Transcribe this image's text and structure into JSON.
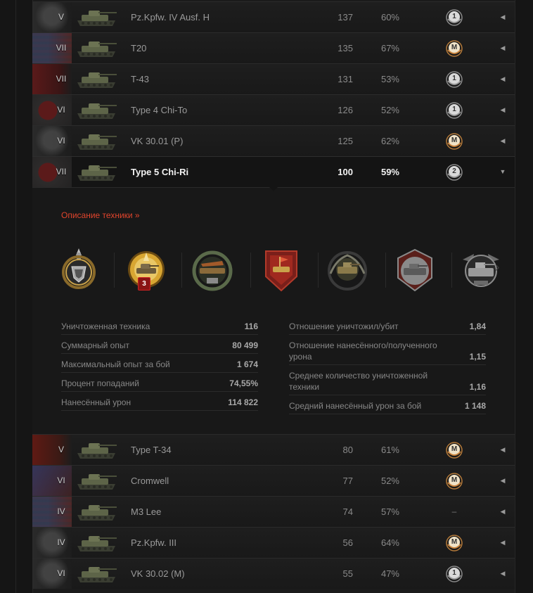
{
  "rows_top": [
    {
      "nation": "germany",
      "tier": "V",
      "name": "Pz.Kpfw. IV Ausf. H",
      "battles": "137",
      "wins": "60%",
      "mastery": "1",
      "mastery_icon": "class-1-badge-icon"
    },
    {
      "nation": "usa",
      "tier": "VII",
      "name": "T20",
      "battles": "135",
      "wins": "67%",
      "mastery": "M",
      "mastery_icon": "ace-tanker-badge-icon"
    },
    {
      "nation": "ussr",
      "tier": "VII",
      "name": "T-43",
      "battles": "131",
      "wins": "53%",
      "mastery": "1",
      "mastery_icon": "class-1-badge-icon"
    },
    {
      "nation": "japan",
      "tier": "VI",
      "name": "Type 4 Chi-To",
      "battles": "126",
      "wins": "52%",
      "mastery": "1",
      "mastery_icon": "class-1-badge-icon"
    },
    {
      "nation": "germany",
      "tier": "VI",
      "name": "VK 30.01 (P)",
      "battles": "125",
      "wins": "62%",
      "mastery": "M",
      "mastery_icon": "ace-tanker-badge-icon"
    },
    {
      "nation": "japan",
      "tier": "VII",
      "name": "Type 5 Chi-Ri",
      "battles": "100",
      "wins": "59%",
      "mastery": "2",
      "mastery_icon": "class-2-badge-icon"
    }
  ],
  "details": {
    "description_link": "Описание техники »",
    "medal_count": "3",
    "stats_left": [
      {
        "label": "Уничтоженная техника",
        "value": "116"
      },
      {
        "label": "Суммарный опыт",
        "value": "80 499"
      },
      {
        "label": "Максимальный опыт за бой",
        "value": "1 674"
      },
      {
        "label": "Процент попаданий",
        "value": "74,55%"
      },
      {
        "label": "Нанесённый урон",
        "value": "114 822"
      }
    ],
    "stats_right": [
      {
        "label": "Отношение уничтожил/убит",
        "label2": "",
        "value": "1,84"
      },
      {
        "label": "Отношение нанесённого/полученного",
        "label2": "урона",
        "value": "1,15"
      },
      {
        "label": "Среднее количество уничтоженной",
        "label2": "техники",
        "value": "1,16"
      },
      {
        "label": "Средний нанесённый урон за бой",
        "label2": "",
        "value": "1 148"
      }
    ]
  },
  "rows_bottom": [
    {
      "nation": "china",
      "tier": "V",
      "name": "Type T-34",
      "battles": "80",
      "wins": "61%",
      "mastery": "M",
      "mastery_icon": "ace-tanker-badge-icon"
    },
    {
      "nation": "uk",
      "tier": "VI",
      "name": "Cromwell",
      "battles": "77",
      "wins": "52%",
      "mastery": "M",
      "mastery_icon": "ace-tanker-badge-icon"
    },
    {
      "nation": "usa",
      "tier": "IV",
      "name": "M3 Lee",
      "battles": "74",
      "wins": "57%",
      "mastery": "–",
      "mastery_icon": ""
    },
    {
      "nation": "germany",
      "tier": "IV",
      "name": "Pz.Kpfw. III",
      "battles": "56",
      "wins": "64%",
      "mastery": "M",
      "mastery_icon": "ace-tanker-badge-icon"
    },
    {
      "nation": "germany",
      "tier": "VI",
      "name": "VK 30.02 (M)",
      "battles": "55",
      "wins": "47%",
      "mastery": "1",
      "mastery_icon": "class-1-badge-icon"
    }
  ],
  "colors": {
    "accent_link": "#e0442c",
    "active_text": "#f2f2f2",
    "muted_text": "#8a8a8a"
  }
}
